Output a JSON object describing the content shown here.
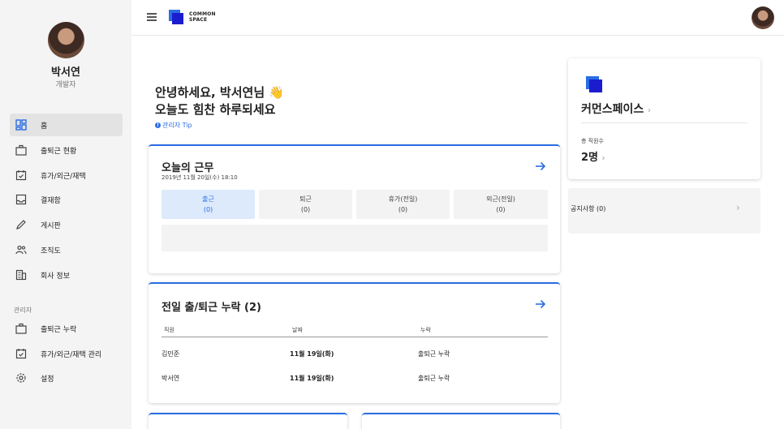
{
  "profile": {
    "name": "박서연",
    "role": "개발자"
  },
  "sidebar": {
    "items": [
      {
        "label": "홈",
        "icon": "dashboard-icon"
      },
      {
        "label": "출퇴근 현황",
        "icon": "briefcase-icon"
      },
      {
        "label": "휴가/외근/재택",
        "icon": "calendar-check-icon"
      },
      {
        "label": "결재함",
        "icon": "inbox-icon"
      },
      {
        "label": "게시판",
        "icon": "pencil-icon"
      },
      {
        "label": "조직도",
        "icon": "people-icon"
      },
      {
        "label": "회사 정보",
        "icon": "building-icon"
      }
    ],
    "admin_section": "관리자",
    "admin_items": [
      {
        "label": "출퇴근 누락",
        "icon": "briefcase-icon"
      },
      {
        "label": "휴가/외근/재택 관리",
        "icon": "calendar-check-icon"
      },
      {
        "label": "설정",
        "icon": "gear-icon"
      }
    ]
  },
  "header": {
    "logo_line1": "COMMON",
    "logo_line2": "SPACE"
  },
  "greeting": {
    "line1": "안녕하세요, 박서연님 👋",
    "line2": "오늘도 힘찬 하루되세요",
    "tip": "관리자 Tip"
  },
  "today": {
    "title": "오늘의 근무",
    "datetime": "2019년 11월 20일(수) 18:10",
    "statuses": [
      {
        "label": "출근",
        "count": "(0)"
      },
      {
        "label": "퇴근",
        "count": "(0)"
      },
      {
        "label": "휴가(전일)",
        "count": "(0)"
      },
      {
        "label": "외근(전일)",
        "count": "(0)"
      }
    ]
  },
  "missing": {
    "title": "전일 출/퇴근 누락 (2)",
    "columns": [
      "직원",
      "날짜",
      "누락"
    ],
    "rows": [
      {
        "name": "김민준",
        "date": "11월 19일(화)",
        "type": "출퇴근 누락"
      },
      {
        "name": "박서연",
        "date": "11월 19일(화)",
        "type": "출퇴근 누락"
      }
    ]
  },
  "company": {
    "name": "커먼스페이스",
    "employees_label": "총 직원수",
    "employees_count": "2명"
  },
  "notice": {
    "label": "공지사항 (0)"
  },
  "colors": {
    "accent": "#2a6de5",
    "sidebar_bg": "#f4f4f4"
  }
}
